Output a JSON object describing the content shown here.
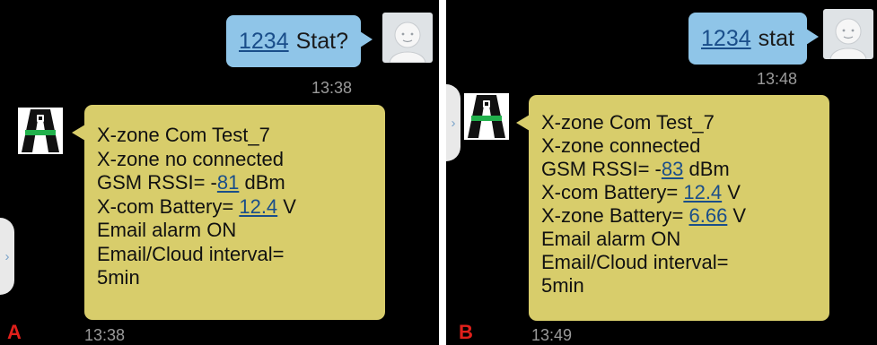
{
  "panels": [
    {
      "label": "A",
      "sent": {
        "pin": "1234",
        "text": "Stat?",
        "time": "13:38"
      },
      "received": {
        "lines": [
          {
            "text": "X-zone Com Test_7"
          },
          {
            "text": "X-zone no connected"
          },
          {
            "prefix": "GSM RSSI= -",
            "value": "81",
            "suffix": " dBm"
          },
          {
            "prefix": "X-com Battery= ",
            "value": "12.4",
            "suffix": " V"
          },
          {
            "text": "Email alarm ON"
          },
          {
            "text": "Email/Cloud  interval="
          },
          {
            "text": "5min"
          }
        ],
        "time": "13:38"
      }
    },
    {
      "label": "B",
      "sent": {
        "pin": "1234",
        "text": "stat",
        "time": "13:48"
      },
      "received": {
        "lines": [
          {
            "text": "X-zone Com Test_7"
          },
          {
            "text": "X-zone connected"
          },
          {
            "prefix": "GSM RSSI= -",
            "value": "83",
            "suffix": " dBm"
          },
          {
            "prefix": "X-com Battery= ",
            "value": "12.4",
            "suffix": " V"
          },
          {
            "prefix": "X-zone Battery= ",
            "value": "6.66",
            "suffix": " V"
          },
          {
            "text": "Email alarm ON"
          },
          {
            "text": "Email/Cloud  interval="
          },
          {
            "text": "5min"
          }
        ],
        "time": "13:49"
      }
    }
  ],
  "icons": {
    "sender_avatar": "person-avatar-icon",
    "app_icon": "x-zone-app-icon",
    "expand_tab": "chevron-right-icon"
  },
  "side_tab_glyph": "›",
  "colors": {
    "background": "#000000",
    "sent_bubble": "#8fc5e8",
    "received_bubble": "#d8cd6b",
    "link": "#1a4e8a",
    "timestamp": "#9a9a9a",
    "panel_label": "#e0201b",
    "app_icon_band": "#22b14c"
  }
}
